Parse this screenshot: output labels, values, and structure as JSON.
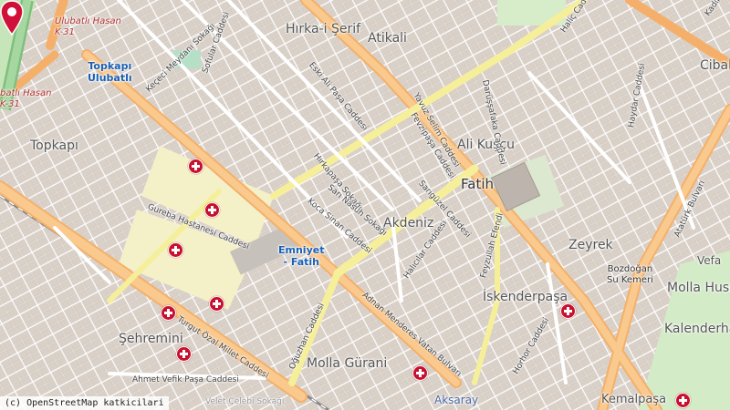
{
  "map": {
    "attribution": "(c) OpenStreetMap katkicilari",
    "districts": [
      {
        "id": "hirka",
        "text": "Hırka-i Şerif"
      },
      {
        "id": "atikali",
        "text": "Atikali"
      },
      {
        "id": "topkapi",
        "text": "Topkapı"
      },
      {
        "id": "fatih",
        "text": "Fatih"
      },
      {
        "id": "akdeniz",
        "text": "Akdeniz"
      },
      {
        "id": "alikuscu",
        "text": "Ali Kuşçu"
      },
      {
        "id": "zeyrek",
        "text": "Zeyrek"
      },
      {
        "id": "iskenderpasa",
        "text": "İskenderpaşa"
      },
      {
        "id": "sehremini",
        "text": "Şehremini"
      },
      {
        "id": "mollagurani",
        "text": "Molla Gürani"
      },
      {
        "id": "mollahusrev",
        "text": "Molla Husr"
      },
      {
        "id": "kalenderhane",
        "text": "Kalenderha"
      },
      {
        "id": "cibali",
        "text": "Cibal"
      },
      {
        "id": "vefa",
        "text": "Vefa"
      },
      {
        "id": "aksaray",
        "text": "Aksaray"
      },
      {
        "id": "kemalpasa",
        "text": "Kemalpaşa"
      }
    ],
    "pois": [
      {
        "id": "topkapi_ulubatli",
        "text": "Topkapı\nUlubatlı"
      },
      {
        "id": "emniyet",
        "text": "Emniyet\n- Fatih"
      },
      {
        "id": "bozdogan",
        "text": "Bozdoğan\nSu Kemeri"
      }
    ],
    "road_labels": [
      {
        "id": "ulubatli_top",
        "text": "Ulubatlı Hasan\nK-31"
      },
      {
        "id": "ulubatli_left",
        "text": "batlı Hasan\nK-31"
      },
      {
        "id": "halic",
        "text": "Haliç Cad"
      },
      {
        "id": "kadir",
        "text": "Kadir"
      },
      {
        "id": "ataturk",
        "text": "Atatürk Bulvarı"
      },
      {
        "id": "fevzipasa",
        "text": "Fevzipaşa Caddesi"
      },
      {
        "id": "adnan",
        "text": "Adnan Menderes Vatan Bulvarı"
      },
      {
        "id": "turgut",
        "text": "Turgut Özal Millet Caddesi"
      },
      {
        "id": "ahmetvefik",
        "text": "Ahmet Vefik Paşa Caddesi"
      },
      {
        "id": "oguzhan",
        "text": "Oğuzhan Caddesi"
      },
      {
        "id": "gureba",
        "text": "Gureba Hastanesi Caddesi"
      },
      {
        "id": "kocasinan",
        "text": "Koca Sinan Caddesi"
      },
      {
        "id": "sangulzel",
        "text": "Sarıgüzel Caddesi"
      },
      {
        "id": "halicilar",
        "text": "Halıcılar Caddesi"
      },
      {
        "id": "darussafaka",
        "text": "Darüşşafaka Caddesi"
      },
      {
        "id": "eskialipasa",
        "text": "Eski Ali Paşa Caddesi"
      },
      {
        "id": "kececi",
        "text": "Keçeci Meydanı Sokağı"
      },
      {
        "id": "sofular",
        "text": "Sofular Caddesi"
      },
      {
        "id": "velicelebi",
        "text": "Velet Çelebi Sokağı"
      },
      {
        "id": "hurkapasa",
        "text": "Hırkapaşa Sokağı"
      },
      {
        "id": "sarinasuh",
        "text": "Sarı Nasuh Sokağı"
      },
      {
        "id": "yavuz",
        "text": "Yavuz Selim Caddesi"
      },
      {
        "id": "haydar",
        "text": "Haydar Caddesi"
      },
      {
        "id": "horhor",
        "text": "Horhor Caddesi"
      },
      {
        "id": "feyzullah",
        "text": "Feyzullah Efendi"
      }
    ]
  }
}
